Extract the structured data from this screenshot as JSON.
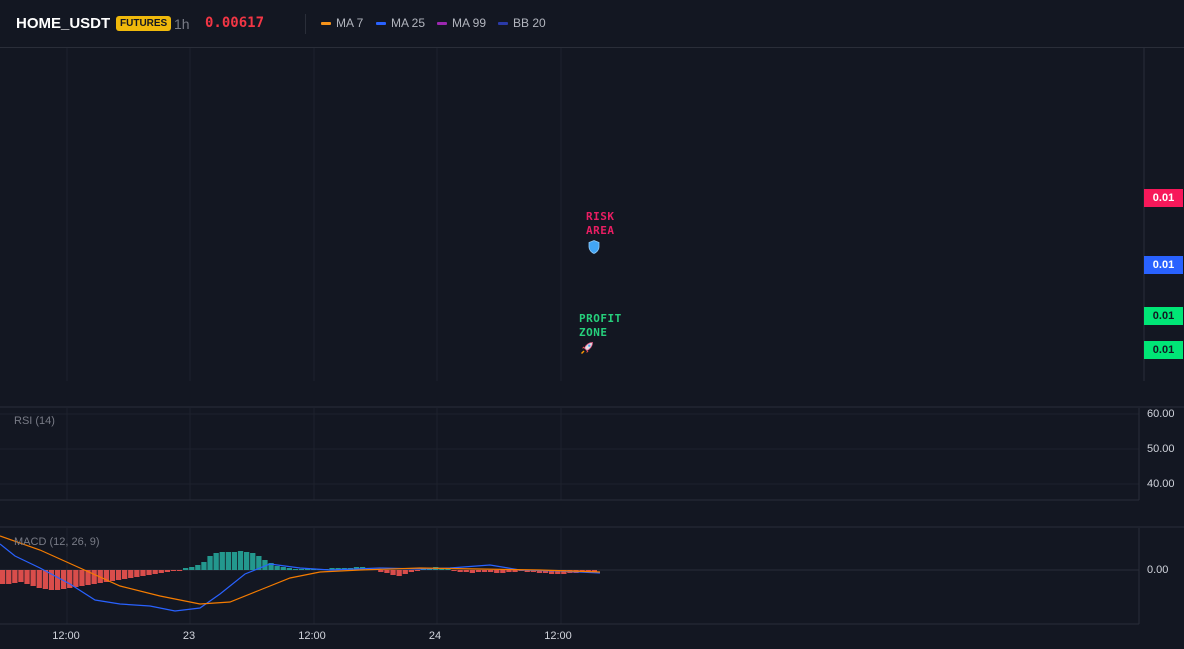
{
  "header": {
    "symbol": "HOME_USDT",
    "badge": "FUTURES",
    "interval": "1h",
    "price": "0.00617",
    "legend": [
      {
        "label": "MA 7",
        "color": "#f7931a"
      },
      {
        "label": "MA 25",
        "color": "#2962ff"
      },
      {
        "label": "MA 99",
        "color": "#9c27b0"
      },
      {
        "label": "BB 20",
        "color": "#2a3aa8"
      }
    ]
  },
  "main": {
    "price_tags": [
      {
        "label": "0.01",
        "color": "#f7185a"
      },
      {
        "label": "0.01",
        "color": "#2962ff"
      },
      {
        "label": "0.01",
        "color": "#00e676"
      },
      {
        "label": "0.01",
        "color": "#00e676"
      }
    ],
    "risk": {
      "line1": "RISK",
      "line2": "AREA",
      "icon": "shield-icon",
      "color": "#e91e63"
    },
    "profit": {
      "line1": "PROFIT",
      "line2": "ZONE",
      "icon": "rocket-icon",
      "color": "#26d07c"
    }
  },
  "rsi": {
    "title": "RSI (14)",
    "ticks": [
      "60.00",
      "50.00",
      "40.00"
    ]
  },
  "macd": {
    "title": "MACD (12, 26, 9)",
    "zero_label": "0.00",
    "up_color": "#26a69a",
    "down_color": "#ef5350",
    "macd_color": "#2962ff",
    "signal_color": "#f57c00"
  },
  "time_axis": [
    "12:00",
    "23",
    "12:00",
    "24",
    "12:00"
  ]
}
